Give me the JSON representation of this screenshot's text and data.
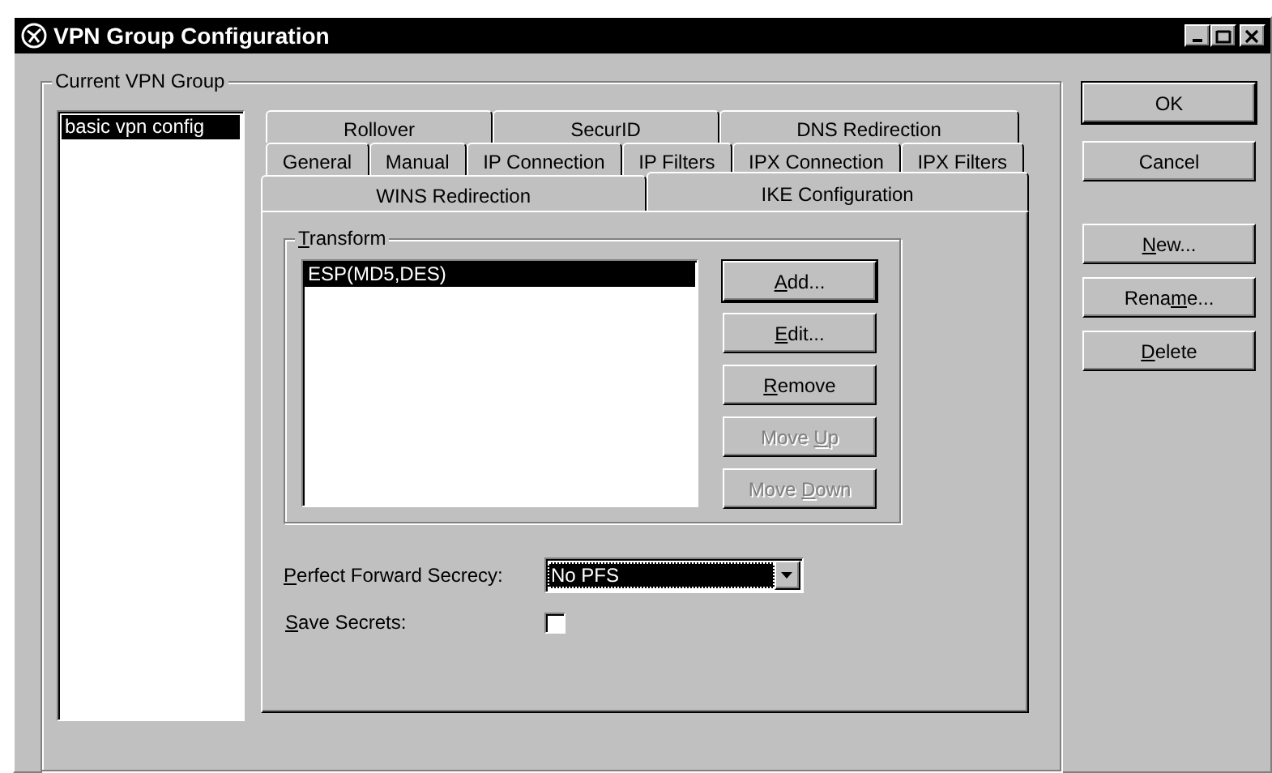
{
  "window": {
    "title": "VPN Group Configuration"
  },
  "group": {
    "label": "Current VPN Group",
    "items": [
      {
        "label": "basic vpn config",
        "selected": true
      }
    ]
  },
  "tab_rows": [
    [
      {
        "label": "Rollover",
        "selected": false
      },
      {
        "label": "SecurID",
        "selected": false
      },
      {
        "label": "DNS Redirection",
        "selected": false
      }
    ],
    [
      {
        "label": "General",
        "selected": false
      },
      {
        "label": "Manual",
        "selected": false
      },
      {
        "label": "IP Connection",
        "selected": false
      },
      {
        "label": "IP Filters",
        "selected": false
      },
      {
        "label": "IPX Connection",
        "selected": false
      },
      {
        "label": "IPX Filters",
        "selected": false
      }
    ],
    [
      {
        "label": "WINS Redirection",
        "selected": false
      },
      {
        "label": "IKE Configuration",
        "selected": true
      }
    ]
  ],
  "transform": {
    "label": {
      "key": "T",
      "post": "ransform"
    },
    "items": [
      {
        "label": "ESP(MD5,DES)",
        "selected": true
      }
    ],
    "buttons": [
      {
        "key": "A",
        "post": "dd...",
        "disabled": false,
        "default": true
      },
      {
        "key": "E",
        "post": "dit...",
        "disabled": false,
        "default": false
      },
      {
        "key": "R",
        "post": "emove",
        "disabled": false,
        "default": false
      },
      {
        "pre": "Move ",
        "key": "U",
        "post": "p",
        "disabled": true,
        "default": false
      },
      {
        "pre": "Move ",
        "key": "D",
        "post": "own",
        "disabled": true,
        "default": false
      }
    ]
  },
  "pfs": {
    "label": {
      "key": "P",
      "post": "erfect Forward Secrecy:"
    },
    "value": "No PFS"
  },
  "save_secrets": {
    "label": {
      "key": "S",
      "post": "ave Secrets:"
    },
    "checked": false
  },
  "side_buttons": [
    {
      "pre": "OK",
      "default": true
    },
    {
      "pre": "Cancel",
      "default": false
    },
    {
      "key": "N",
      "post": "ew...",
      "default": false
    },
    {
      "pre": "Rena",
      "key": "m",
      "post": "e...",
      "default": false
    },
    {
      "key": "D",
      "post": "elete",
      "default": false
    }
  ]
}
